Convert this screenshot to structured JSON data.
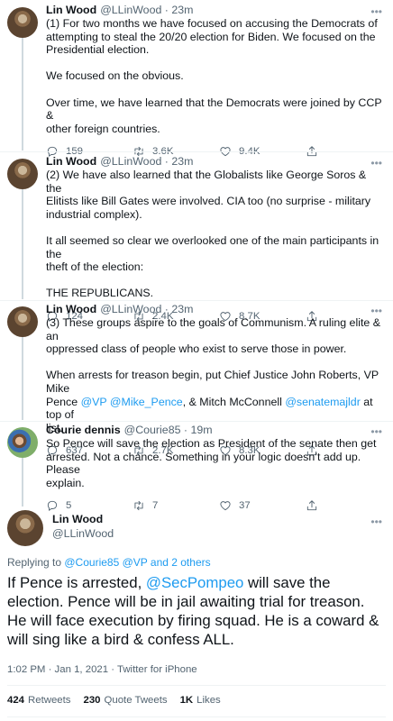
{
  "tweets": [
    {
      "name": "Lin Wood",
      "handle": "@LLinWood · 23m",
      "lines": [
        "(1) For two months we have focused on accusing the Democrats of",
        "attempting to steal the 20/20 election for Biden. We focused on the",
        "Presidential election.",
        "",
        "We focused on the obvious.",
        "",
        "Over time, we have learned that the Democrats were joined by CCP &",
        "other foreign countries."
      ],
      "replies": "159",
      "retweets": "3.6K",
      "likes": "9.4K"
    },
    {
      "name": "Lin Wood",
      "handle": "@LLinWood · 23m",
      "lines": [
        "(2) We have also learned that the Globalists like George Soros & the",
        "Elitists like Bill Gates were involved. CIA too (no surprise - military",
        "industrial complex).",
        "",
        "It all seemed so clear we overlooked one of the main participants in the",
        "theft of the election:",
        "",
        "THE REPUBLICANS."
      ],
      "replies": "124",
      "retweets": "2.4K",
      "likes": "8.7K"
    },
    {
      "name": "Lin Wood",
      "handle": "@LLinWood · 23m",
      "line1": "(3) These groups aspire to the goals of Communism. A ruling elite & an",
      "line2": "oppressed class of people who exist to serve those in power.",
      "line3": "When arrests for treason begin, put Chief Justice John Roberts, VP Mike",
      "line4_a": "Pence ",
      "line4_m1": "@VP",
      "line4_m2": "@Mike_Pence",
      "line4_b": ", & Mitch McConnell ",
      "line4_m3": "@senatemajldr",
      "line4_c": " at top of",
      "line5": "list.",
      "replies": "637",
      "retweets": "2.7K",
      "likes": "8.3K"
    },
    {
      "name": "Courie dennis",
      "handle": "@Courie85 · 19m",
      "lines": [
        "So Pence will save the election as President of the senate then get",
        "arrested. Not a chance. Something in your logic doesn’t add up. Please",
        "explain."
      ],
      "replies": "5",
      "retweets": "7",
      "likes": "37"
    }
  ],
  "main": {
    "name": "Lin Wood",
    "handle": "@LLinWood",
    "replying_prefix": "Replying to ",
    "replying_to": "@Courie85 @VP and 2 others",
    "text_a": "If Pence is arrested, ",
    "text_mention": "@SecPompeo",
    "text_b": " will save the election. Pence will be in jail awaiting trial for treason. He will face execution by firing squad. He is a coward & will sing like a bird & confess ALL.",
    "timestamp": "1:02 PM · Jan 1, 2021 · Twitter for iPhone",
    "retweets_count": "424",
    "retweets_label": "Retweets",
    "quotes_count": "230",
    "quotes_label": "Quote Tweets",
    "likes_count": "1K",
    "likes_label": "Likes"
  },
  "colors": {
    "accent": "#1d9bf0",
    "secondary_text": "#536471"
  }
}
